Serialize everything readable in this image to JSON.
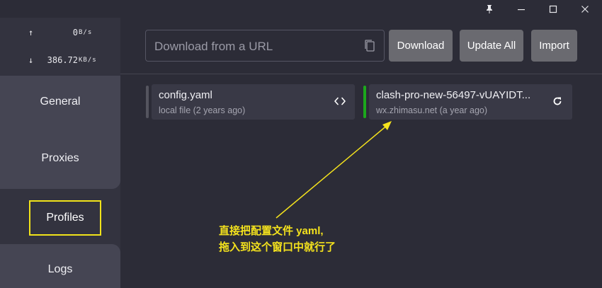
{
  "window": {
    "pin_glyph": "📌",
    "minimize_glyph": "—",
    "maximize_glyph": "☐",
    "close_glyph": "✕"
  },
  "traffic": {
    "up_arrow": "↑",
    "up_value": "0",
    "up_unit": "B/s",
    "down_arrow": "↓",
    "down_value": "386.72",
    "down_unit": "KB/s"
  },
  "nav": {
    "general": "General",
    "proxies": "Proxies",
    "profiles": "Profiles",
    "logs": "Logs"
  },
  "toolbar": {
    "url_placeholder": "Download from a URL",
    "download": "Download",
    "update_all": "Update All",
    "import": "Import"
  },
  "profiles": [
    {
      "name": "config.yaml",
      "source": "local file (2 years ago)",
      "active": false,
      "action_icon": "code-icon"
    },
    {
      "name": "clash-pro-new-56497-vUAYIDT...",
      "source": "wx.zhimasu.net (a year ago)",
      "active": true,
      "action_icon": "refresh-icon"
    }
  ],
  "annotation": {
    "line1": "直接把配置文件 yaml,",
    "line2": "拖入到这个窗口中就行了"
  },
  "colors": {
    "active_indicator": "#1ca81c",
    "inactive_indicator": "#55555f",
    "annotation": "#f4e21d"
  }
}
